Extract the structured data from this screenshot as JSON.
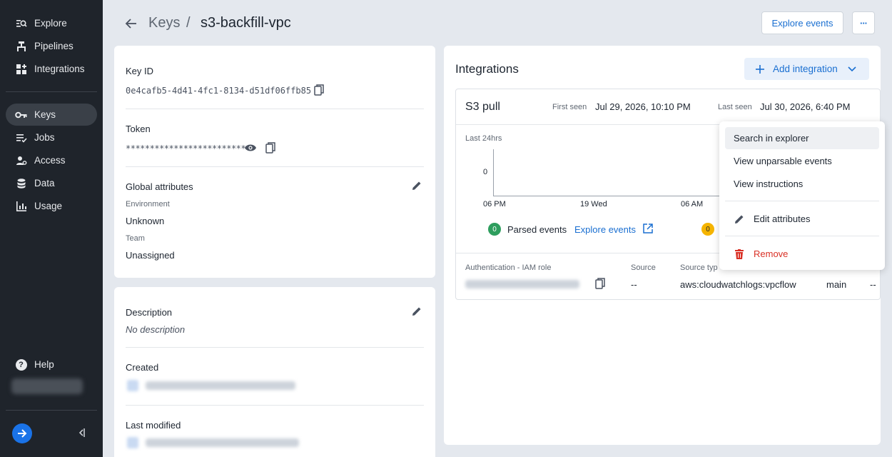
{
  "sidebar": {
    "items": [
      {
        "label": "Explore"
      },
      {
        "label": "Pipelines"
      },
      {
        "label": "Integrations"
      },
      {
        "label": "Keys"
      },
      {
        "label": "Jobs"
      },
      {
        "label": "Access"
      },
      {
        "label": "Data"
      },
      {
        "label": "Usage"
      }
    ],
    "help_label": "Help"
  },
  "header": {
    "breadcrumb_parent": "Keys",
    "breadcrumb_sep": "/",
    "title": "s3-backfill-vpc",
    "explore_events_label": "Explore events",
    "more_label": "···"
  },
  "key_card": {
    "key_id_label": "Key ID",
    "key_id_value": "0e4cafb5-4d41-4fc1-8134-d51df06ffb85",
    "token_label": "Token",
    "token_value": "**************************",
    "global_attributes_label": "Global attributes",
    "environment_label": "Environment",
    "environment_value": "Unknown",
    "team_label": "Team",
    "team_value": "Unassigned"
  },
  "desc_card": {
    "description_label": "Description",
    "description_value": "No description",
    "created_label": "Created",
    "last_modified_label": "Last modified"
  },
  "integrations": {
    "title": "Integrations",
    "add_label": "Add integration",
    "card": {
      "name": "S3 pull",
      "first_seen_label": "First seen",
      "first_seen_value": "Jul 29, 2026, 10:10 PM",
      "last_seen_label": "Last seen",
      "last_seen_value": "Jul 30, 2026, 6:40 PM",
      "chart_range_label": "Last 24hrs",
      "y_tick": "0",
      "x_ticks": [
        "06 PM",
        "19 Wed",
        "06 AM"
      ],
      "parsed_count": "0",
      "parsed_label": "Parsed events",
      "explore_link": "Explore events",
      "unparsed_count": "0",
      "auth_label": "Authentication - IAM role",
      "source_label": "Source",
      "source_value": "--",
      "source_type_label": "Source typ",
      "source_type_value": "aws:cloudwatchlogs:vpcflow",
      "index_value": "main",
      "extra_value": "--"
    }
  },
  "menu": {
    "items": [
      {
        "label": "Search in explorer"
      },
      {
        "label": "View unparsable events"
      },
      {
        "label": "View instructions"
      },
      {
        "label": "Edit attributes"
      },
      {
        "label": "Remove"
      }
    ]
  },
  "colors": {
    "accent": "#1a6fd1",
    "success": "#2e9e5e",
    "warning": "#f5b400",
    "danger": "#d93025",
    "sidebar_bg": "#1f242b"
  }
}
